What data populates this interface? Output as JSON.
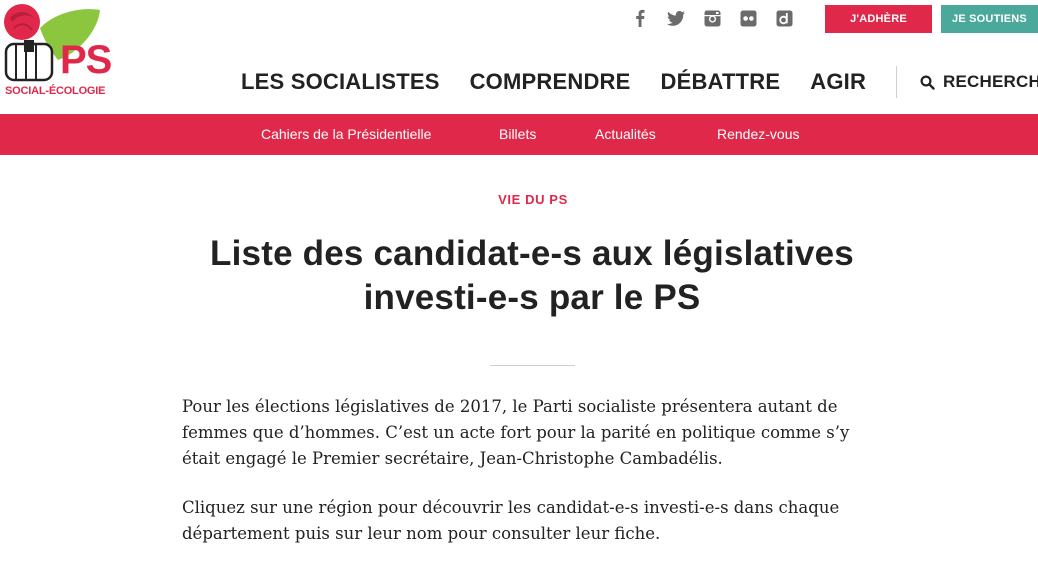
{
  "logo": {
    "text": "PS",
    "subtitle": "SOCIAL-ÉCOLOGIE"
  },
  "social": [
    {
      "icon": "facebook-icon"
    },
    {
      "icon": "twitter-icon"
    },
    {
      "icon": "instagram-icon"
    },
    {
      "icon": "flickr-icon"
    },
    {
      "icon": "dailymotion-icon"
    }
  ],
  "buttons": {
    "adhere": "J'ADHÈRE",
    "soutiens": "JE SOUTIENS"
  },
  "main_nav": [
    {
      "label": "LES SOCIALISTES"
    },
    {
      "label": "COMPRENDRE"
    },
    {
      "label": "DÉBATTRE"
    },
    {
      "label": "AGIR"
    }
  ],
  "search": {
    "label": "RECHERCH"
  },
  "sub_nav": [
    {
      "label": "Cahiers de la Présidentielle"
    },
    {
      "label": "Billets"
    },
    {
      "label": "Actualités"
    },
    {
      "label": "Rendez-vous"
    }
  ],
  "article": {
    "category": "VIE DU PS",
    "title_line1": "Liste des candidat-e-s aux législatives",
    "title_line2": "investi-e-s par le PS",
    "paragraph1": "Pour les élections législatives de 2017, le Parti socialiste présentera autant de femmes que d’hommes. C’est un acte fort pour la parité en politique comme s’y était engagé le Premier secrétaire, Jean-Christophe Cambadélis.",
    "paragraph2": "Cliquez sur une région pour découvrir les candidat-e-s investi-e-s dans chaque département puis sur leur nom pour consulter leur fiche."
  },
  "colors": {
    "brand_red": "#e0294a",
    "brand_teal": "#4aa99a",
    "logo_green": "#8cc63f",
    "icon_grey": "#6b6b6b"
  }
}
